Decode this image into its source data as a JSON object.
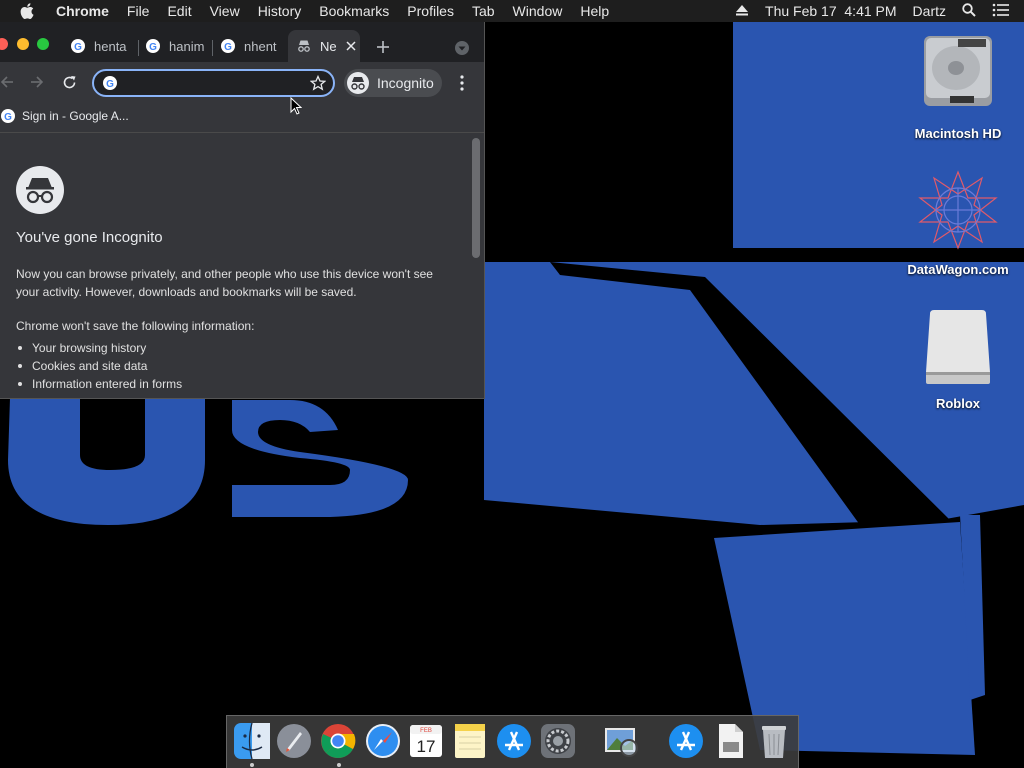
{
  "menubar": {
    "app_name": "Chrome",
    "items": [
      "File",
      "Edit",
      "View",
      "History",
      "Bookmarks",
      "Profiles",
      "Tab",
      "Window",
      "Help"
    ],
    "datetime": "Thu Feb 17  4:41 PM",
    "user": "Dartz"
  },
  "browser": {
    "tabs": [
      {
        "title": "henta"
      },
      {
        "title": "hanim"
      },
      {
        "title": "nhent"
      },
      {
        "title": "Ne"
      }
    ],
    "omnibox": {
      "value": "",
      "placeholder": ""
    },
    "incognito_label": "Incognito",
    "bookmarks": [
      {
        "label": "Sign in - Google A..."
      }
    ]
  },
  "incognito_page": {
    "heading": "You've gone Incognito",
    "paragraph_line1": "Now you can browse privately, and other people who use this device won't see",
    "paragraph_line2": "your activity. However, downloads and bookmarks will be saved.",
    "wont_save": "Chrome won't save the following information:",
    "list": [
      "Your browsing history",
      "Cookies and site data",
      "Information entered in forms"
    ]
  },
  "desktop_icons": [
    {
      "label": "Macintosh HD",
      "icon": "hard-drive-icon"
    },
    {
      "label": "DataWagon.com",
      "icon": "star-pattern-icon"
    },
    {
      "label": "Roblox",
      "icon": "external-drive-icon"
    }
  ],
  "dock": {
    "apps": [
      "finder-icon",
      "launchpad-icon",
      "chrome-icon",
      "safari-icon",
      "calendar-icon",
      "notes-icon",
      "app-store-icon",
      "system-preferences-icon",
      "preview-icon",
      "applications-folder-icon",
      "documents-icon",
      "trash-icon"
    ],
    "calendar": {
      "month": "FEB",
      "day": "17"
    }
  },
  "colors": {
    "wallpaper_blue": "#2a55b0",
    "chrome_dark": "#35363a",
    "tabstrip": "#202124",
    "focus_ring": "#8ab4f8"
  }
}
